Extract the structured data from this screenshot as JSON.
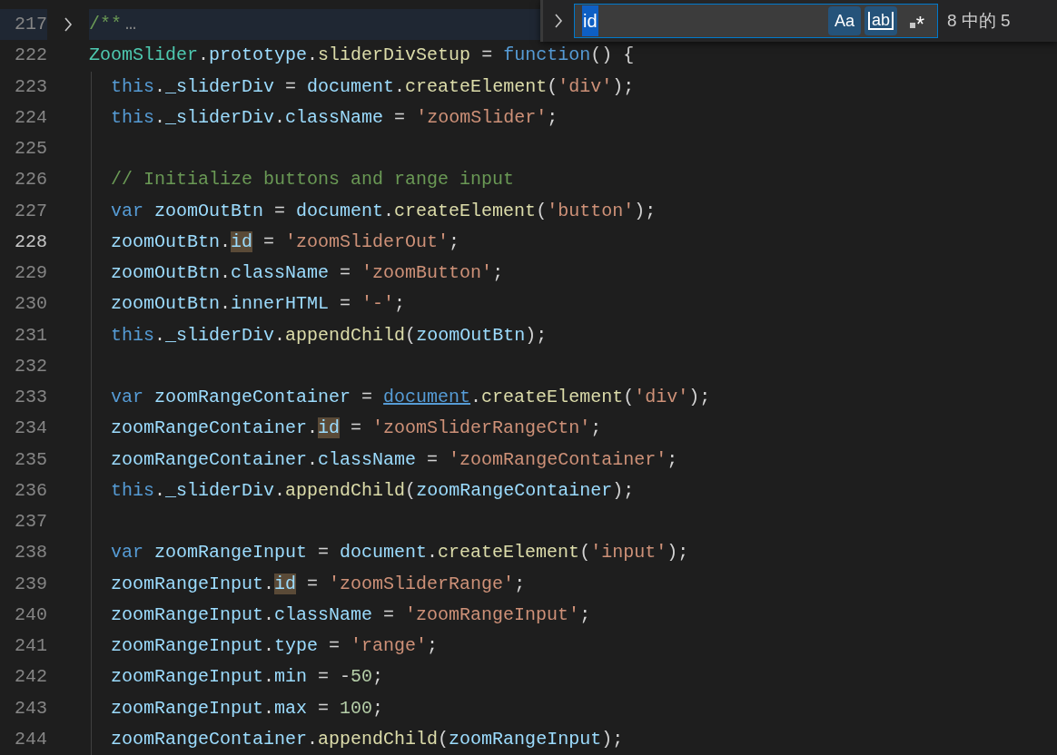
{
  "editor": {
    "lines": [
      {
        "number": "217",
        "current": false,
        "folded": true,
        "indent_guide": false,
        "tokens": [
          {
            "kind": "comment",
            "t": "/**"
          },
          {
            "kind": "ellipsis",
            "t": "…"
          }
        ]
      },
      {
        "number": "222",
        "current": false,
        "folded": false,
        "indent_guide": false,
        "tokens": [
          {
            "kind": "class",
            "t": "ZoomSlider"
          },
          {
            "kind": "punct",
            "t": "."
          },
          {
            "kind": "var",
            "t": "prototype"
          },
          {
            "kind": "punct",
            "t": "."
          },
          {
            "kind": "func",
            "t": "sliderDivSetup"
          },
          {
            "kind": "punct",
            "t": " = "
          },
          {
            "kind": "keyword",
            "t": "function"
          },
          {
            "kind": "punct",
            "t": "() {"
          }
        ]
      },
      {
        "number": "223",
        "current": false,
        "folded": false,
        "indent_guide": true,
        "tokens": [
          {
            "kind": "keyword",
            "t": "  this"
          },
          {
            "kind": "punct",
            "t": "."
          },
          {
            "kind": "var",
            "t": "_sliderDiv"
          },
          {
            "kind": "punct",
            "t": " = "
          },
          {
            "kind": "var",
            "t": "document"
          },
          {
            "kind": "punct",
            "t": "."
          },
          {
            "kind": "func",
            "t": "createElement"
          },
          {
            "kind": "punct",
            "t": "("
          },
          {
            "kind": "str",
            "t": "'div'"
          },
          {
            "kind": "punct",
            "t": ");"
          }
        ]
      },
      {
        "number": "224",
        "current": false,
        "folded": false,
        "indent_guide": true,
        "tokens": [
          {
            "kind": "keyword",
            "t": "  this"
          },
          {
            "kind": "punct",
            "t": "."
          },
          {
            "kind": "var",
            "t": "_sliderDiv"
          },
          {
            "kind": "punct",
            "t": "."
          },
          {
            "kind": "var",
            "t": "className"
          },
          {
            "kind": "punct",
            "t": " = "
          },
          {
            "kind": "str",
            "t": "'zoomSlider'"
          },
          {
            "kind": "punct",
            "t": ";"
          }
        ]
      },
      {
        "number": "225",
        "current": false,
        "folded": false,
        "indent_guide": true
      },
      {
        "number": "226",
        "current": false,
        "folded": false,
        "indent_guide": true,
        "tokens": [
          {
            "kind": "comment",
            "t": "  // Initialize buttons and range input"
          }
        ]
      },
      {
        "number": "227",
        "current": false,
        "folded": false,
        "indent_guide": true,
        "tokens": [
          {
            "kind": "keyword",
            "t": "  var"
          },
          {
            "kind": "var",
            "t": " zoomOutBtn"
          },
          {
            "kind": "punct",
            "t": " = "
          },
          {
            "kind": "var",
            "t": "document"
          },
          {
            "kind": "punct",
            "t": "."
          },
          {
            "kind": "func",
            "t": "createElement"
          },
          {
            "kind": "punct",
            "t": "("
          },
          {
            "kind": "str",
            "t": "'button'"
          },
          {
            "kind": "punct",
            "t": ");"
          }
        ]
      },
      {
        "number": "228",
        "current": true,
        "folded": false,
        "indent_guide": true,
        "tokens": [
          {
            "kind": "var",
            "t": "  zoomOutBtn"
          },
          {
            "kind": "punct",
            "t": "."
          },
          {
            "kind": "match",
            "t": "id"
          },
          {
            "kind": "punct",
            "t": " = "
          },
          {
            "kind": "str",
            "t": "'zoomSliderOut'"
          },
          {
            "kind": "punct",
            "t": ";"
          }
        ]
      },
      {
        "number": "229",
        "current": false,
        "folded": false,
        "indent_guide": true,
        "tokens": [
          {
            "kind": "var",
            "t": "  zoomOutBtn"
          },
          {
            "kind": "punct",
            "t": "."
          },
          {
            "kind": "var",
            "t": "className"
          },
          {
            "kind": "punct",
            "t": " = "
          },
          {
            "kind": "str",
            "t": "'zoomButton'"
          },
          {
            "kind": "punct",
            "t": ";"
          }
        ]
      },
      {
        "number": "230",
        "current": false,
        "folded": false,
        "indent_guide": true,
        "tokens": [
          {
            "kind": "var",
            "t": "  zoomOutBtn"
          },
          {
            "kind": "punct",
            "t": "."
          },
          {
            "kind": "var",
            "t": "innerHTML"
          },
          {
            "kind": "punct",
            "t": " = "
          },
          {
            "kind": "str",
            "t": "'-'"
          },
          {
            "kind": "punct",
            "t": ";"
          }
        ]
      },
      {
        "number": "231",
        "current": false,
        "folded": false,
        "indent_guide": true,
        "tokens": [
          {
            "kind": "keyword",
            "t": "  this"
          },
          {
            "kind": "punct",
            "t": "."
          },
          {
            "kind": "var",
            "t": "_sliderDiv"
          },
          {
            "kind": "punct",
            "t": "."
          },
          {
            "kind": "func",
            "t": "appendChild"
          },
          {
            "kind": "punct",
            "t": "("
          },
          {
            "kind": "var",
            "t": "zoomOutBtn"
          },
          {
            "kind": "punct",
            "t": ");"
          }
        ]
      },
      {
        "number": "232",
        "current": false,
        "folded": false,
        "indent_guide": true
      },
      {
        "number": "233",
        "current": false,
        "folded": false,
        "indent_guide": true,
        "tokens": [
          {
            "kind": "keyword",
            "t": "  var"
          },
          {
            "kind": "var",
            "t": " zoomRangeContainer"
          },
          {
            "kind": "punct",
            "t": " = "
          },
          {
            "kind": "link",
            "t": "document"
          },
          {
            "kind": "punct",
            "t": "."
          },
          {
            "kind": "func",
            "t": "createElement"
          },
          {
            "kind": "punct",
            "t": "("
          },
          {
            "kind": "str",
            "t": "'div'"
          },
          {
            "kind": "punct",
            "t": ");"
          }
        ]
      },
      {
        "number": "234",
        "current": false,
        "folded": false,
        "indent_guide": true,
        "tokens": [
          {
            "kind": "var",
            "t": "  zoomRangeContainer"
          },
          {
            "kind": "punct",
            "t": "."
          },
          {
            "kind": "match",
            "t": "id"
          },
          {
            "kind": "punct",
            "t": " = "
          },
          {
            "kind": "str",
            "t": "'zoomSliderRangeCtn'"
          },
          {
            "kind": "punct",
            "t": ";"
          }
        ]
      },
      {
        "number": "235",
        "current": false,
        "folded": false,
        "indent_guide": true,
        "tokens": [
          {
            "kind": "var",
            "t": "  zoomRangeContainer"
          },
          {
            "kind": "punct",
            "t": "."
          },
          {
            "kind": "var",
            "t": "className"
          },
          {
            "kind": "punct",
            "t": " = "
          },
          {
            "kind": "str",
            "t": "'zoomRangeContainer'"
          },
          {
            "kind": "punct",
            "t": ";"
          }
        ]
      },
      {
        "number": "236",
        "current": false,
        "folded": false,
        "indent_guide": true,
        "tokens": [
          {
            "kind": "keyword",
            "t": "  this"
          },
          {
            "kind": "punct",
            "t": "."
          },
          {
            "kind": "var",
            "t": "_sliderDiv"
          },
          {
            "kind": "punct",
            "t": "."
          },
          {
            "kind": "func",
            "t": "appendChild"
          },
          {
            "kind": "punct",
            "t": "("
          },
          {
            "kind": "var",
            "t": "zoomRangeContainer"
          },
          {
            "kind": "punct",
            "t": ");"
          }
        ]
      },
      {
        "number": "237",
        "current": false,
        "folded": false,
        "indent_guide": true
      },
      {
        "number": "238",
        "current": false,
        "folded": false,
        "indent_guide": true,
        "tokens": [
          {
            "kind": "keyword",
            "t": "  var"
          },
          {
            "kind": "var",
            "t": " zoomRangeInput"
          },
          {
            "kind": "punct",
            "t": " = "
          },
          {
            "kind": "var",
            "t": "document"
          },
          {
            "kind": "punct",
            "t": "."
          },
          {
            "kind": "func",
            "t": "createElement"
          },
          {
            "kind": "punct",
            "t": "("
          },
          {
            "kind": "str",
            "t": "'input'"
          },
          {
            "kind": "punct",
            "t": ");"
          }
        ]
      },
      {
        "number": "239",
        "current": false,
        "folded": false,
        "indent_guide": true,
        "tokens": [
          {
            "kind": "var",
            "t": "  zoomRangeInput"
          },
          {
            "kind": "punct",
            "t": "."
          },
          {
            "kind": "match",
            "t": "id"
          },
          {
            "kind": "punct",
            "t": " = "
          },
          {
            "kind": "str",
            "t": "'zoomSliderRange'"
          },
          {
            "kind": "punct",
            "t": ";"
          }
        ]
      },
      {
        "number": "240",
        "current": false,
        "folded": false,
        "indent_guide": true,
        "tokens": [
          {
            "kind": "var",
            "t": "  zoomRangeInput"
          },
          {
            "kind": "punct",
            "t": "."
          },
          {
            "kind": "var",
            "t": "className"
          },
          {
            "kind": "punct",
            "t": " = "
          },
          {
            "kind": "str",
            "t": "'zoomRangeInput'"
          },
          {
            "kind": "punct",
            "t": ";"
          }
        ]
      },
      {
        "number": "241",
        "current": false,
        "folded": false,
        "indent_guide": true,
        "tokens": [
          {
            "kind": "var",
            "t": "  zoomRangeInput"
          },
          {
            "kind": "punct",
            "t": "."
          },
          {
            "kind": "var",
            "t": "type"
          },
          {
            "kind": "punct",
            "t": " = "
          },
          {
            "kind": "str",
            "t": "'range'"
          },
          {
            "kind": "punct",
            "t": ";"
          }
        ]
      },
      {
        "number": "242",
        "current": false,
        "folded": false,
        "indent_guide": true,
        "tokens": [
          {
            "kind": "var",
            "t": "  zoomRangeInput"
          },
          {
            "kind": "punct",
            "t": "."
          },
          {
            "kind": "var",
            "t": "min"
          },
          {
            "kind": "punct",
            "t": " = -"
          },
          {
            "kind": "num",
            "t": "50"
          },
          {
            "kind": "punct",
            "t": ";"
          }
        ]
      },
      {
        "number": "243",
        "current": false,
        "folded": false,
        "indent_guide": true,
        "tokens": [
          {
            "kind": "var",
            "t": "  zoomRangeInput"
          },
          {
            "kind": "punct",
            "t": "."
          },
          {
            "kind": "var",
            "t": "max"
          },
          {
            "kind": "punct",
            "t": " = "
          },
          {
            "kind": "num",
            "t": "100"
          },
          {
            "kind": "punct",
            "t": ";"
          }
        ]
      },
      {
        "number": "244",
        "current": false,
        "folded": false,
        "indent_guide": true,
        "tokens": [
          {
            "kind": "var",
            "t": "  zoomRangeContainer"
          },
          {
            "kind": "punct",
            "t": "."
          },
          {
            "kind": "func",
            "t": "appendChild"
          },
          {
            "kind": "punct",
            "t": "("
          },
          {
            "kind": "var",
            "t": "zoomRangeInput"
          },
          {
            "kind": "punct",
            "t": ");"
          }
        ]
      }
    ]
  },
  "find_widget": {
    "value": "id",
    "options": [
      {
        "kind": "case",
        "label": "Aa",
        "on": true
      },
      {
        "kind": "word",
        "label": "ab",
        "on": true
      },
      {
        "kind": "regex",
        "label": "*",
        "on": false
      }
    ],
    "count": "8 中的 5"
  }
}
